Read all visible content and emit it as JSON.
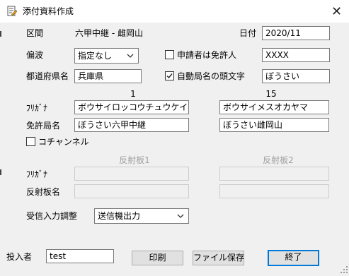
{
  "window": {
    "title": "添付資料作成",
    "close_glyph": "✕"
  },
  "section": {
    "label": "区間",
    "value": "六甲中継 - 雌岡山"
  },
  "date": {
    "label": "日付",
    "value": "2020/11"
  },
  "polarization": {
    "label": "偏波",
    "value": "指定なし"
  },
  "applicant_licensee": {
    "label": "申請者は免許人",
    "checked": false,
    "value": "XXXX"
  },
  "prefecture": {
    "label": "都道府県名",
    "value": "兵庫県"
  },
  "auto_station_prefix": {
    "label": "自動局名の頭文字",
    "checked": true,
    "value": "ぼうさい"
  },
  "columns": {
    "left": "1",
    "right": "15"
  },
  "furigana": {
    "label": "ﾌﾘｶﾞﾅ",
    "left": "ボウサイロッコウチュウケイ",
    "right": "ボウサイメスオカヤマ"
  },
  "license_station": {
    "label": "免許局名",
    "left": "ぼうさい六甲中継",
    "right": "ぼうさい雌岡山"
  },
  "cochannel": {
    "label": "コチャンネル",
    "checked": false
  },
  "reflectors": {
    "header1": "反射板1",
    "header2": "反射板2"
  },
  "reflector_furigana": {
    "label": "ﾌﾘｶﾞﾅ",
    "value1": "",
    "value2": ""
  },
  "reflector_name": {
    "label": "反射板名",
    "value1": "",
    "value2": ""
  },
  "rx_adjust": {
    "label": "受信入力調整",
    "value": "送信機出力"
  },
  "submitter": {
    "label": "投入者",
    "value": "test"
  },
  "buttons": {
    "print": "印刷",
    "save_file": "ファイル保存",
    "finish": "終了"
  }
}
